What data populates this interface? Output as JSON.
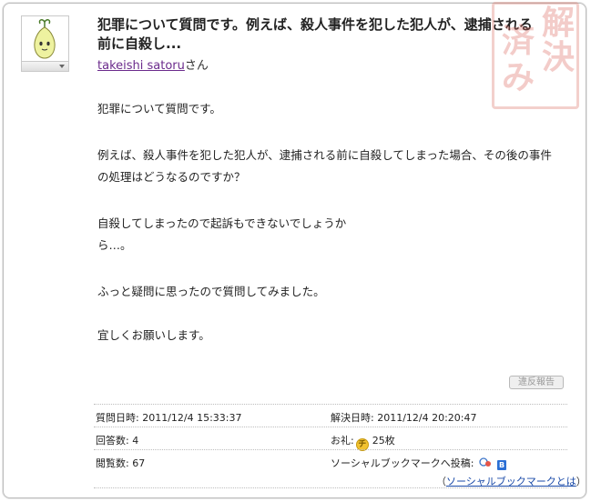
{
  "question": {
    "title": "犯罪について質問です。例えば、殺人事件を犯した犯人が、逮捕される前に自殺し...",
    "author_name": "takeishi satoru",
    "author_suffix": "さん",
    "stamp_chars": [
      "解",
      "決",
      "済",
      "み"
    ],
    "avatar_icon": "sprout-character-icon",
    "body": [
      "犯罪について質問です。",
      "例えば、殺人事件を犯した犯人が、逮捕される前に自殺してしまった場合、その後の事件",
      "の処理はどうなるのですか？",
      "自殺してしまったので起訴もできないでしょうか",
      "ら…。",
      "ふっと疑問に思ったので質問してみました。",
      "宜しくお願いします。"
    ],
    "report_label": "違反報告"
  },
  "info": {
    "asked_label": "質問日時: 2011/12/4 15:33:37",
    "resolved_label": "解決日時: 2011/12/4 20:20:47",
    "answers_label": "回答数: 4",
    "reward_label": "お礼:",
    "reward_coin": "チ",
    "reward_value": "25枚",
    "views_label": "閲覧数: 67",
    "social_label": "ソーシャルブックマークへ投稿:",
    "social_icon_b": "B"
  },
  "footer": {
    "paren_open": "（",
    "link": "ソーシャルブックマークとは",
    "paren_close": "）"
  }
}
